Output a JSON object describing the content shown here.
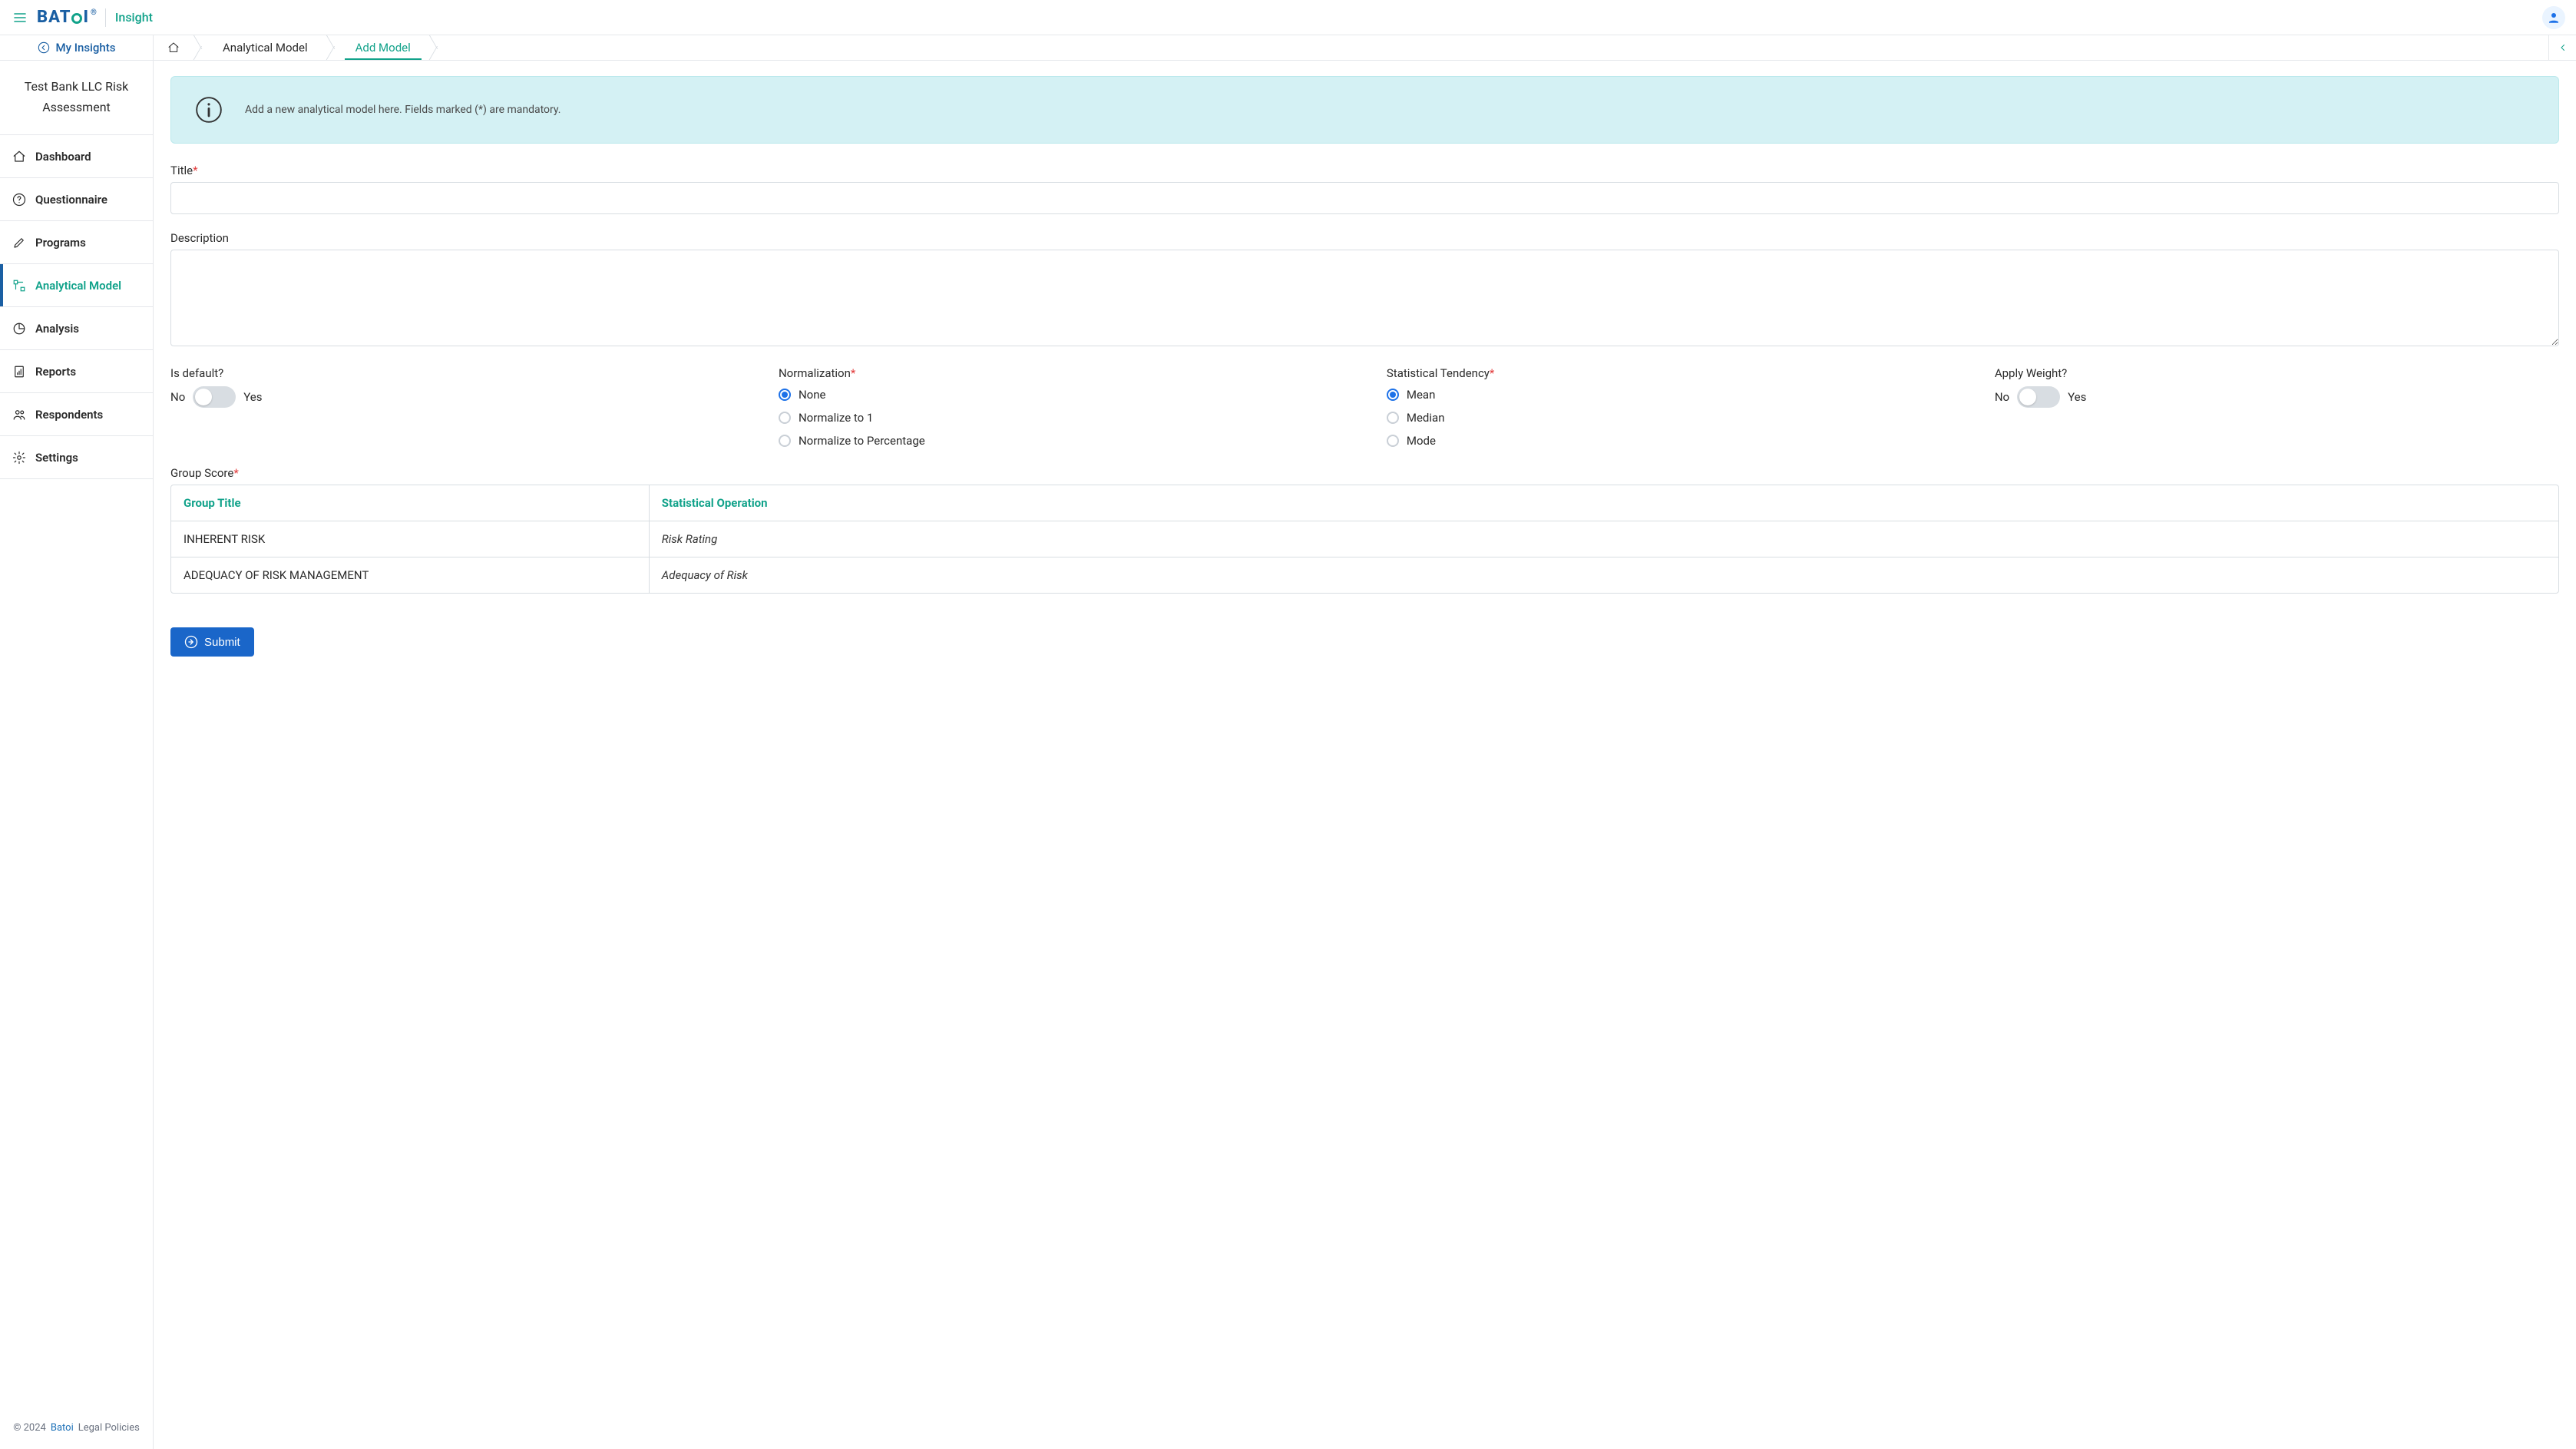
{
  "header": {
    "brand_primary": "BAT",
    "brand_suffix": "I",
    "brand_reg": "®",
    "product": "Insight"
  },
  "sidebar": {
    "my_insights_label": "My Insights",
    "project_name": "Test Bank LLC Risk Assessment",
    "items": [
      {
        "icon": "home",
        "label": "Dashboard"
      },
      {
        "icon": "help",
        "label": "Questionnaire"
      },
      {
        "icon": "pen",
        "label": "Programs"
      },
      {
        "icon": "model",
        "label": "Analytical Model",
        "active": true
      },
      {
        "icon": "pie",
        "label": "Analysis"
      },
      {
        "icon": "report",
        "label": "Reports"
      },
      {
        "icon": "users",
        "label": "Respondents"
      },
      {
        "icon": "gear",
        "label": "Settings"
      }
    ],
    "footer": {
      "copyright": "© 2024",
      "brand": "Batoi",
      "legal": "Legal Policies"
    }
  },
  "breadcrumbs": {
    "items": [
      {
        "label": "Analytical Model"
      },
      {
        "label": "Add Model",
        "active": true
      }
    ]
  },
  "banner": {
    "text": "Add a new analytical model here. Fields marked (*) are mandatory."
  },
  "form": {
    "title": {
      "label": "Title",
      "required": true,
      "value": ""
    },
    "description": {
      "label": "Description",
      "required": false,
      "value": ""
    },
    "is_default": {
      "label": "Is default?",
      "no_label": "No",
      "yes_label": "Yes",
      "value": false
    },
    "normalization": {
      "label": "Normalization",
      "required": true,
      "options": [
        "None",
        "Normalize to 1",
        "Normalize to Percentage"
      ],
      "value": "None"
    },
    "stat_tendency": {
      "label": "Statistical Tendency",
      "required": true,
      "options": [
        "Mean",
        "Median",
        "Mode"
      ],
      "value": "Mean"
    },
    "apply_weight": {
      "label": "Apply Weight?",
      "no_label": "No",
      "yes_label": "Yes",
      "value": false
    },
    "group_score": {
      "label": "Group Score",
      "required": true,
      "headers": {
        "group_title": "Group Title",
        "stat_op": "Statistical Operation"
      },
      "rows": [
        {
          "title": "INHERENT RISK",
          "op": "Risk Rating"
        },
        {
          "title": "ADEQUACY OF RISK MANAGEMENT",
          "op": "Adequacy of Risk"
        }
      ]
    },
    "submit_label": "Submit"
  }
}
